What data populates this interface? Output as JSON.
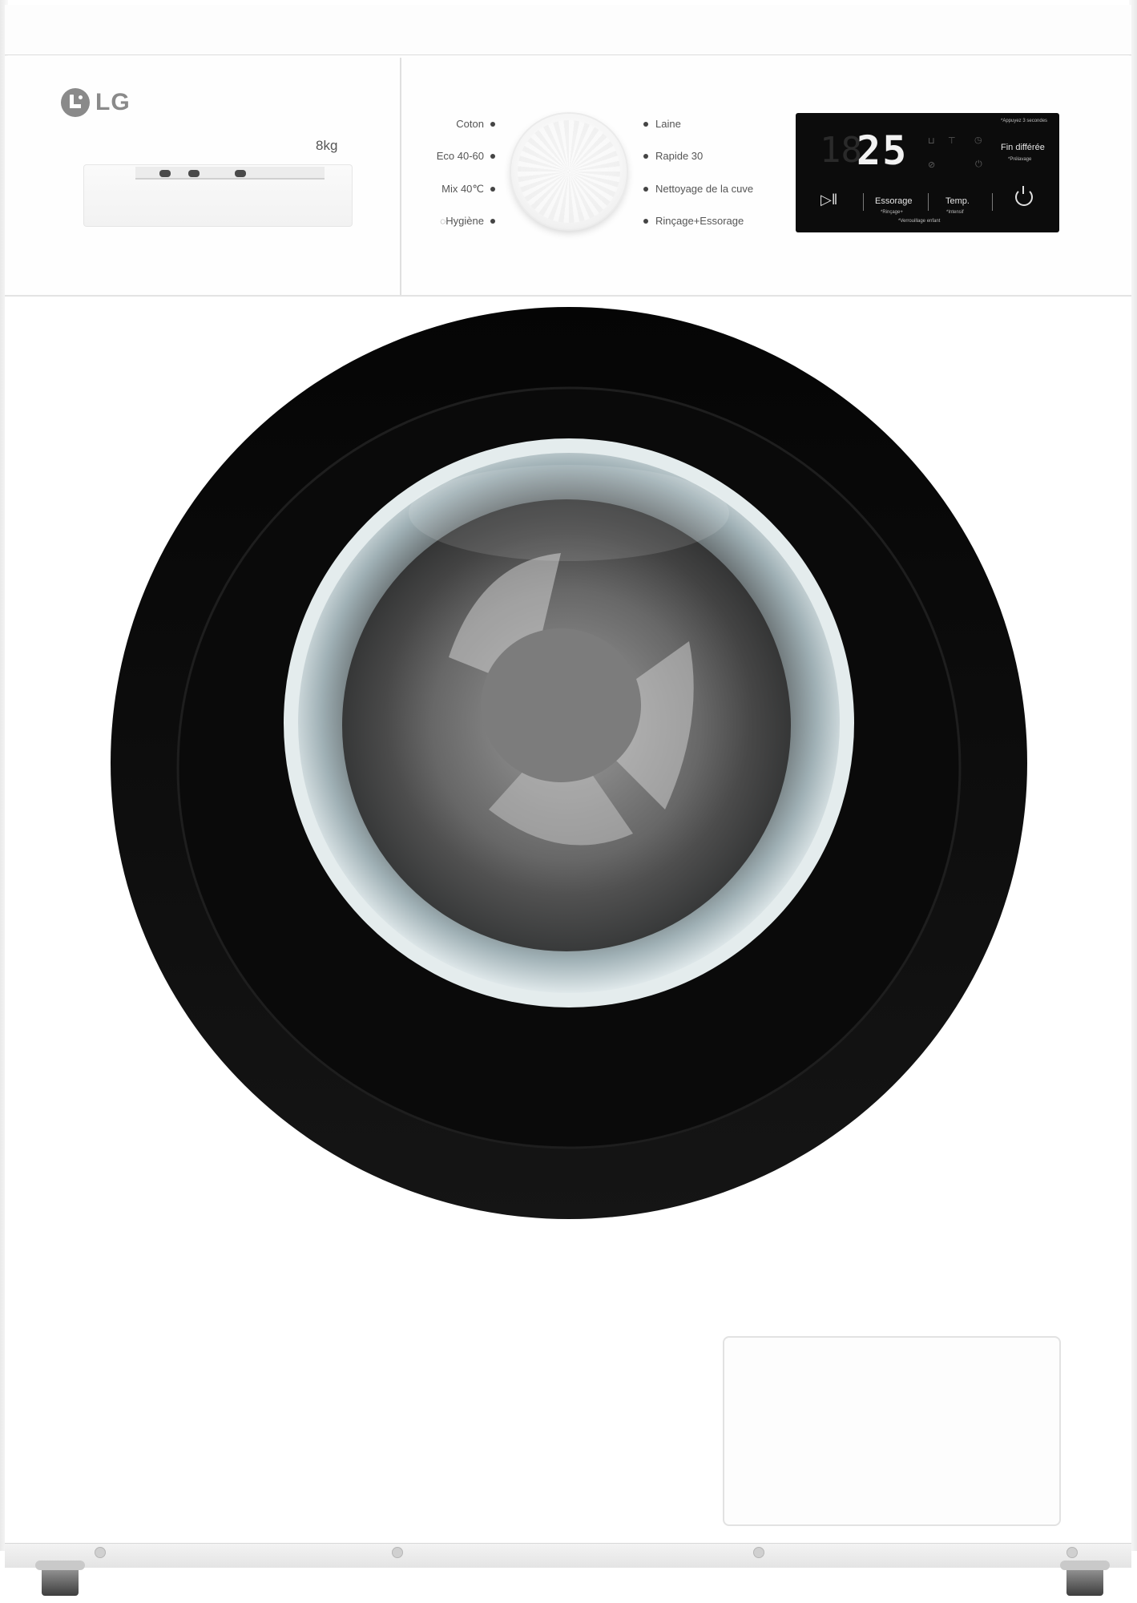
{
  "brand": {
    "logo_text": "LG"
  },
  "capacity": "8kg",
  "programs_left": [
    {
      "label": "Coton"
    },
    {
      "label": "Eco 40-60"
    },
    {
      "label": "Mix 40℃"
    },
    {
      "label": "Hygiène",
      "icon": "hygiene-icon"
    }
  ],
  "programs_right": [
    {
      "label": "Laine"
    },
    {
      "label": "Rapide 30"
    },
    {
      "label": "Nettoyage de la cuve"
    },
    {
      "label": "Rinçage+Essorage"
    }
  ],
  "display": {
    "time": "25",
    "ghost_digits": "18",
    "top_note": "*Appuyez 3 secondes",
    "delay_label": "Fin différée",
    "delay_sub": "*Prélavage",
    "spin_label": "Essorage",
    "spin_sub": "*Rinçage+",
    "temp_label": "Temp.",
    "temp_sub": "*Intensif",
    "lock_note": "*Verrouillage enfant",
    "start_icon": "play-pause-icon",
    "power_icon": "power-icon"
  },
  "colors": {
    "body": "#ffffff",
    "door_ring": "#0a0a0a",
    "display_bg": "#0c0c0c",
    "logo": "#8a8a8a"
  }
}
